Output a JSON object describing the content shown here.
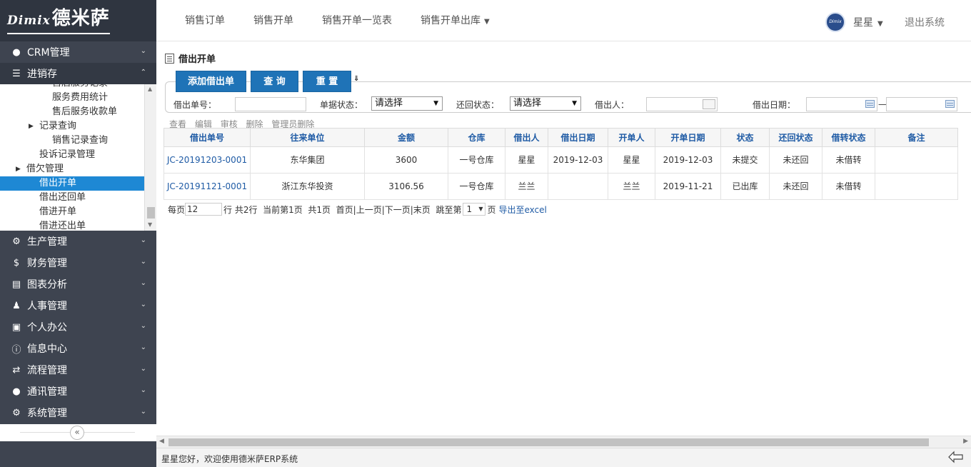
{
  "brand": {
    "en": "Dimix",
    "zh": "德米萨"
  },
  "topnav": {
    "items": [
      "销售订单",
      "销售开单",
      "销售开单一览表",
      "销售开单出库"
    ],
    "user": "星星",
    "logout": "退出系统",
    "avatar_text": "Dimix 德米萨"
  },
  "sidebar": {
    "top_menus": [
      {
        "label": "CRM管理",
        "icon": "user-icon"
      },
      {
        "label": "进销存",
        "icon": "list-icon"
      }
    ],
    "subtree": [
      {
        "label": "售后服务记录",
        "level": 3
      },
      {
        "label": "服务费用统计",
        "level": 3
      },
      {
        "label": "售后服务收款单",
        "level": 3
      },
      {
        "label": "记录查询",
        "level": 2,
        "expandable": true
      },
      {
        "label": "销售记录查询",
        "level": 3
      },
      {
        "label": "投诉记录管理",
        "level": 2
      },
      {
        "label": "借欠管理",
        "level": 1,
        "expandable": true
      },
      {
        "label": "借出开单",
        "level": 2,
        "active": true
      },
      {
        "label": "借出还回单",
        "level": 2
      },
      {
        "label": "借进开单",
        "level": 2
      },
      {
        "label": "借进还出单",
        "level": 2
      }
    ],
    "lower_menus": [
      {
        "label": "生产管理",
        "icon": "gears-icon"
      },
      {
        "label": "财务管理",
        "icon": "dollar-icon"
      },
      {
        "label": "图表分析",
        "icon": "image-icon"
      },
      {
        "label": "人事管理",
        "icon": "users-icon"
      },
      {
        "label": "个人办公",
        "icon": "briefcase-icon"
      },
      {
        "label": "信息中心",
        "icon": "info-icon"
      },
      {
        "label": "流程管理",
        "icon": "exchange-icon"
      },
      {
        "label": "通讯管理",
        "icon": "comments-icon"
      },
      {
        "label": "系统管理",
        "icon": "cog-icon"
      }
    ]
  },
  "page": {
    "title": "借出开单"
  },
  "toolbar": {
    "add": "添加借出单",
    "query": "查 询",
    "reset": "重 置"
  },
  "filters": {
    "loan_no_label": "借出单号：",
    "doc_status_label": "单据状态：",
    "doc_status_value": "请选择",
    "return_status_label": "还回状态：",
    "return_status_value": "请选择",
    "borrower_label": "借出人：",
    "loan_date_label": "借出日期：",
    "date_sep": "—"
  },
  "actions": [
    "查看",
    "编辑",
    "审核",
    "删除",
    "管理员删除"
  ],
  "table": {
    "columns": [
      "借出单号",
      "往来单位",
      "金额",
      "仓库",
      "借出人",
      "借出日期",
      "开单人",
      "开单日期",
      "状态",
      "还回状态",
      "借转状态",
      "备注"
    ],
    "rows": [
      [
        "JC-20191203-0001",
        "东华集团",
        "3600",
        "一号仓库",
        "星星",
        "2019-12-03",
        "星星",
        "2019-12-03",
        "未提交",
        "未还回",
        "未借转",
        ""
      ],
      [
        "JC-20191121-0001",
        "浙江东华投资",
        "3106.56",
        "一号仓库",
        "兰兰",
        "",
        "兰兰",
        "2019-11-21",
        "已出库",
        "未还回",
        "未借转",
        ""
      ]
    ]
  },
  "pager": {
    "per_page_label": "每页",
    "per_page_value": "12",
    "rows_text": "行 共2行",
    "current_text": "当前第1页",
    "total_text": "共1页",
    "nav_text": "首页|上一页|下一页|末页",
    "jump_label": "跳至第",
    "jump_value": "1",
    "page_suffix": "页",
    "export": "导出至excel"
  },
  "status": {
    "text": "星星您好，欢迎使用德米萨ERP系统"
  }
}
